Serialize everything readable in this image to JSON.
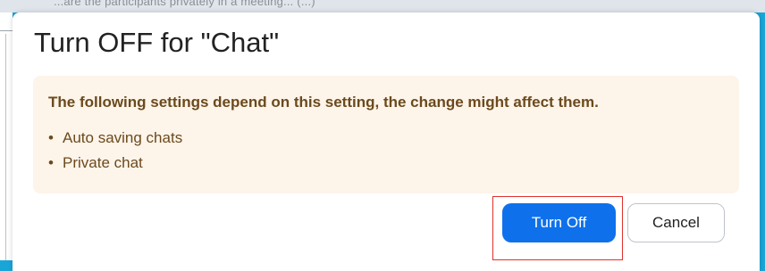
{
  "background": {
    "top_text": "...are the participants privately in a meeting... (...)"
  },
  "dialog": {
    "title": "Turn OFF for \"Chat\"",
    "notice": {
      "heading": "The following settings depend on this setting, the change might affect them.",
      "bullet": "•",
      "items": [
        "Auto saving chats",
        "Private chat"
      ]
    },
    "buttons": {
      "confirm_label": "Turn Off",
      "cancel_label": "Cancel"
    }
  },
  "colors": {
    "primary_button": "#0e71eb",
    "notice_background": "#fdf4ea",
    "notice_text": "#6b4a1c",
    "highlight_border": "#e0312c",
    "page_background": "#1aa5d8"
  }
}
